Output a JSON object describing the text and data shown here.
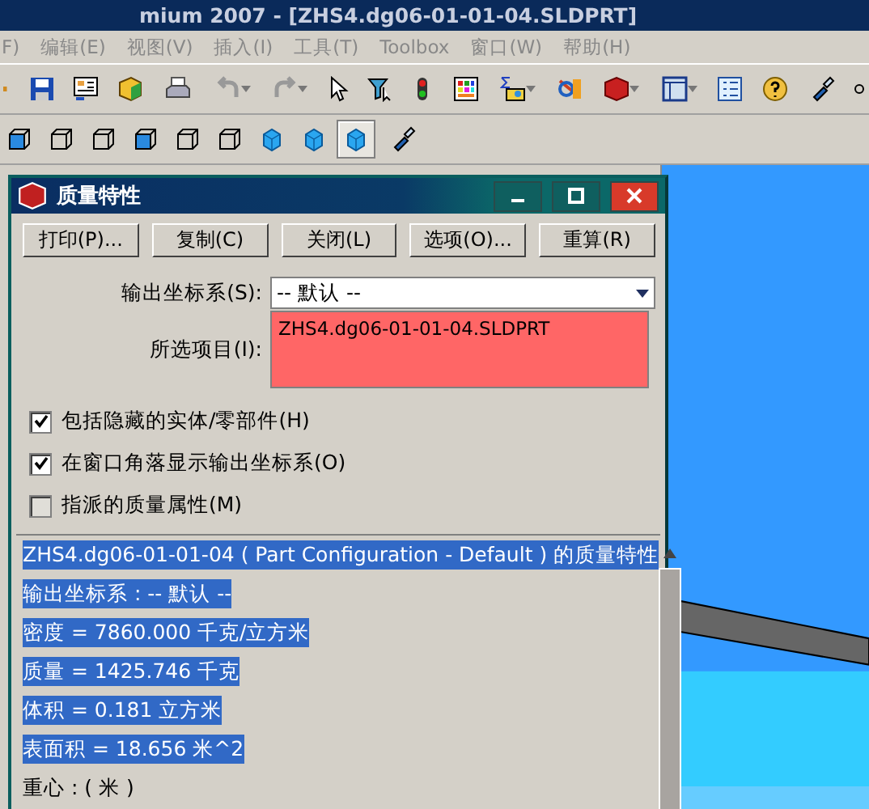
{
  "app": {
    "title": "mium 2007 - [ZHS4.dg06-01-01-04.SLDPRT]",
    "menu": [
      {
        "label": "F)"
      },
      {
        "label": "编辑(E)"
      },
      {
        "label": "视图(V)"
      },
      {
        "label": "插入(I)"
      },
      {
        "label": "工具(T)"
      },
      {
        "label": "Toolbox"
      },
      {
        "label": "窗口(W)"
      },
      {
        "label": "帮助(H)"
      }
    ]
  },
  "view_toolbar": [
    {
      "selected": false
    },
    {
      "selected": false
    },
    {
      "selected": false
    },
    {
      "selected": false
    },
    {
      "selected": false
    },
    {
      "selected": false
    },
    {
      "selected": false
    },
    {
      "selected": false
    },
    {
      "selected": true
    }
  ],
  "dialog": {
    "title": "质量特性",
    "buttons": [
      "打印(P)...",
      "复制(C)",
      "关闭(L)",
      "选项(O)...",
      "重算(R)"
    ],
    "coordinate_system": {
      "label": "输出坐标系(S):",
      "value": "-- 默认 --"
    },
    "selected_items": {
      "label": "所选项目(I):",
      "items": [
        "ZHS4.dg06-01-01-04.SLDPRT"
      ]
    },
    "checkboxes": [
      {
        "label": "包括隐藏的实体/零部件(H)",
        "checked": true,
        "disabled": false
      },
      {
        "label": "在窗口角落显示输出坐标系(O)",
        "checked": true,
        "disabled": false
      },
      {
        "label": "指派的质量属性(M)",
        "checked": false,
        "disabled": true
      }
    ],
    "results": [
      {
        "text": "ZHS4.dg06-01-01-04 ( Part Configuration - Default ) 的质量特性",
        "selected": true
      },
      {
        "text": "输出坐标系 : -- 默认 --",
        "selected": true
      },
      {
        "text": "密度 = 7860.000 千克/立方米",
        "selected": true
      },
      {
        "text": "质量 = 1425.746 千克",
        "selected": true
      },
      {
        "text": "体积 = 0.181 立方米",
        "selected": true
      },
      {
        "text": "表面积 = 18.656 米^2",
        "selected": true
      },
      {
        "text": "重心 : ( 米 )",
        "selected": false
      }
    ]
  }
}
